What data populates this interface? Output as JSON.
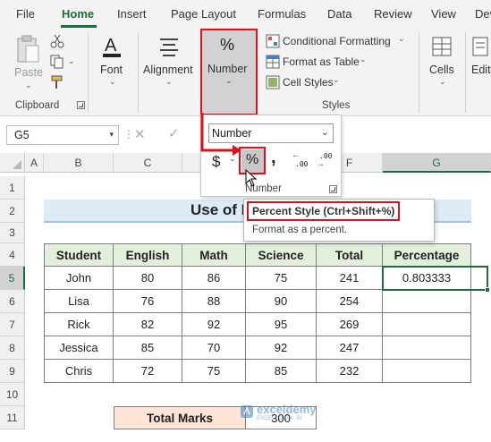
{
  "tabs": [
    "File",
    "Home",
    "Insert",
    "Page Layout",
    "Formulas",
    "Data",
    "Review",
    "View",
    "Dev"
  ],
  "active_tab": "Home",
  "ribbon": {
    "clipboard": {
      "paste": "Paste",
      "group": "Clipboard"
    },
    "font": {
      "label": "Font"
    },
    "alignment": {
      "label": "Alignment"
    },
    "number": {
      "label": "Number",
      "glyph": "%"
    },
    "styles": {
      "conditional_formatting": "Conditional Formatting",
      "format_as_table": "Format as Table",
      "cell_styles": "Cell Styles",
      "group": "Styles"
    },
    "cells": {
      "label": "Cells"
    },
    "editing": {
      "label": "Editi"
    }
  },
  "name_box": "G5",
  "number_panel": {
    "format_value": "Number",
    "currency_symbol": "$",
    "percent_symbol": "%",
    "comma_symbol": ",",
    "increase_decimal": ".00",
    "decrease_decimal": ".00",
    "group": "Number"
  },
  "tooltip": {
    "title": "Percent Style (Ctrl+Shift+%)",
    "description": "Format as a percent."
  },
  "columns": [
    "A",
    "B",
    "C",
    "D",
    "E",
    "F",
    "G"
  ],
  "rows": [
    "1",
    "2",
    "3",
    "4",
    "5",
    "6",
    "7",
    "8",
    "9",
    "10",
    "11"
  ],
  "sheet": {
    "title": "Use of E",
    "headers": [
      "Student",
      "English",
      "Math",
      "Science",
      "Total",
      "Percentage"
    ],
    "records": [
      {
        "student": "John",
        "english": "80",
        "math": "86",
        "science": "75",
        "total": "241",
        "percentage": "0.803333"
      },
      {
        "student": "Lisa",
        "english": "76",
        "math": "88",
        "science": "90",
        "total": "254",
        "percentage": ""
      },
      {
        "student": "Rick",
        "english": "82",
        "math": "92",
        "science": "95",
        "total": "269",
        "percentage": ""
      },
      {
        "student": "Jessica",
        "english": "85",
        "math": "70",
        "science": "92",
        "total": "247",
        "percentage": ""
      },
      {
        "student": "Chris",
        "english": "72",
        "math": "75",
        "science": "85",
        "total": "232",
        "percentage": ""
      }
    ],
    "total_marks_label": "Total Marks",
    "total_marks_value": "300"
  },
  "watermark": {
    "name": "exceldemy",
    "tagline": "EXCEL · DATA · BI"
  },
  "colors": {
    "accent": "#1e6b3e",
    "header_fill": "#e2efda",
    "title_fill": "#ddebf7",
    "total_fill": "#fce4d6",
    "highlight": "#e0101a"
  }
}
